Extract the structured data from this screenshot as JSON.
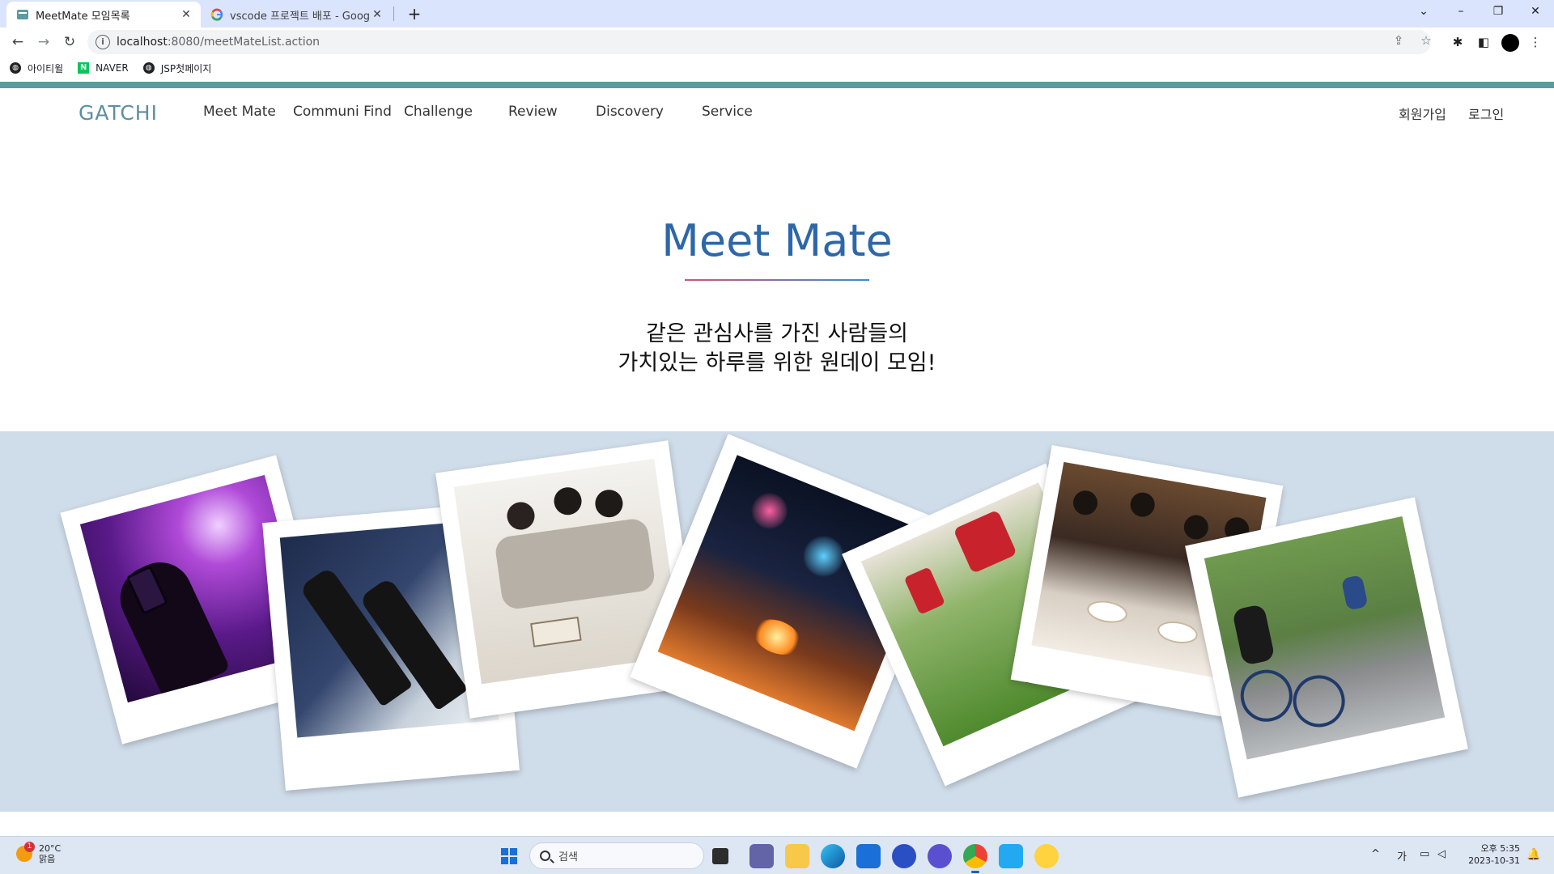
{
  "browser": {
    "tabs": [
      {
        "title": "MeetMate 모임목록",
        "active": true
      },
      {
        "title": "vscode 프로젝트 배포 - Google",
        "active": false
      }
    ],
    "url_host": "localhost",
    "url_rest": ":8080/meetMateList.action",
    "bookmarks": [
      "아이티윌",
      "NAVER",
      "JSP첫페이지"
    ]
  },
  "site": {
    "logo": "GATCHI",
    "menu": [
      "Meet Mate",
      "Communi Find",
      "Challenge",
      "Review",
      "Discovery",
      "Service"
    ],
    "auth": [
      "회원가입",
      "로그인"
    ],
    "hero_title": "Meet Mate",
    "hero_line1": "같은 관심사를 가진 사람들의",
    "hero_line2": "가치있는 하루를 위한 원데이 모임!",
    "gallery_photos": [
      "concert-photo",
      "wine-bottles-photo",
      "book-club-photo",
      "fireworks-bbq-photo",
      "soccer-photo",
      "dinner-party-photo",
      "cycling-photo"
    ]
  },
  "taskbar": {
    "temp": "20°C",
    "weather": "맑음",
    "weather_badge": "1",
    "search_placeholder": "검색",
    "ime": "가",
    "time": "오후 5:35",
    "date": "2023-10-31"
  },
  "colors": {
    "accent_teal": "#5b9aa0",
    "title_blue": "#2e67a8",
    "gallery_bg": "#cfdce9",
    "tabstrip": "#dbe4fd"
  }
}
